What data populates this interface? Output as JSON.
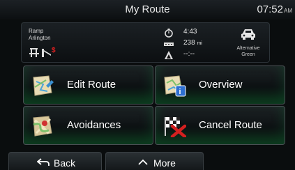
{
  "header": {
    "title": "My Route",
    "time": "07:52",
    "ampm": "AM"
  },
  "info": {
    "road_line1": "Ramp",
    "road_line2": "Arlington",
    "duration": "4:43",
    "distance_value": "238",
    "distance_unit": "mi",
    "eta": "--:--",
    "car_label1": "Alternative",
    "car_label2": "Green"
  },
  "buttons": [
    {
      "label": "Edit Route"
    },
    {
      "label": "Overview"
    },
    {
      "label": "Avoidances"
    },
    {
      "label": "Cancel Route"
    }
  ],
  "bottom": {
    "back_label": "Back",
    "more_label": "More"
  },
  "colors": {
    "accent": "#1f8a4c",
    "toll": "#e02020",
    "cancel": "#d42020"
  }
}
